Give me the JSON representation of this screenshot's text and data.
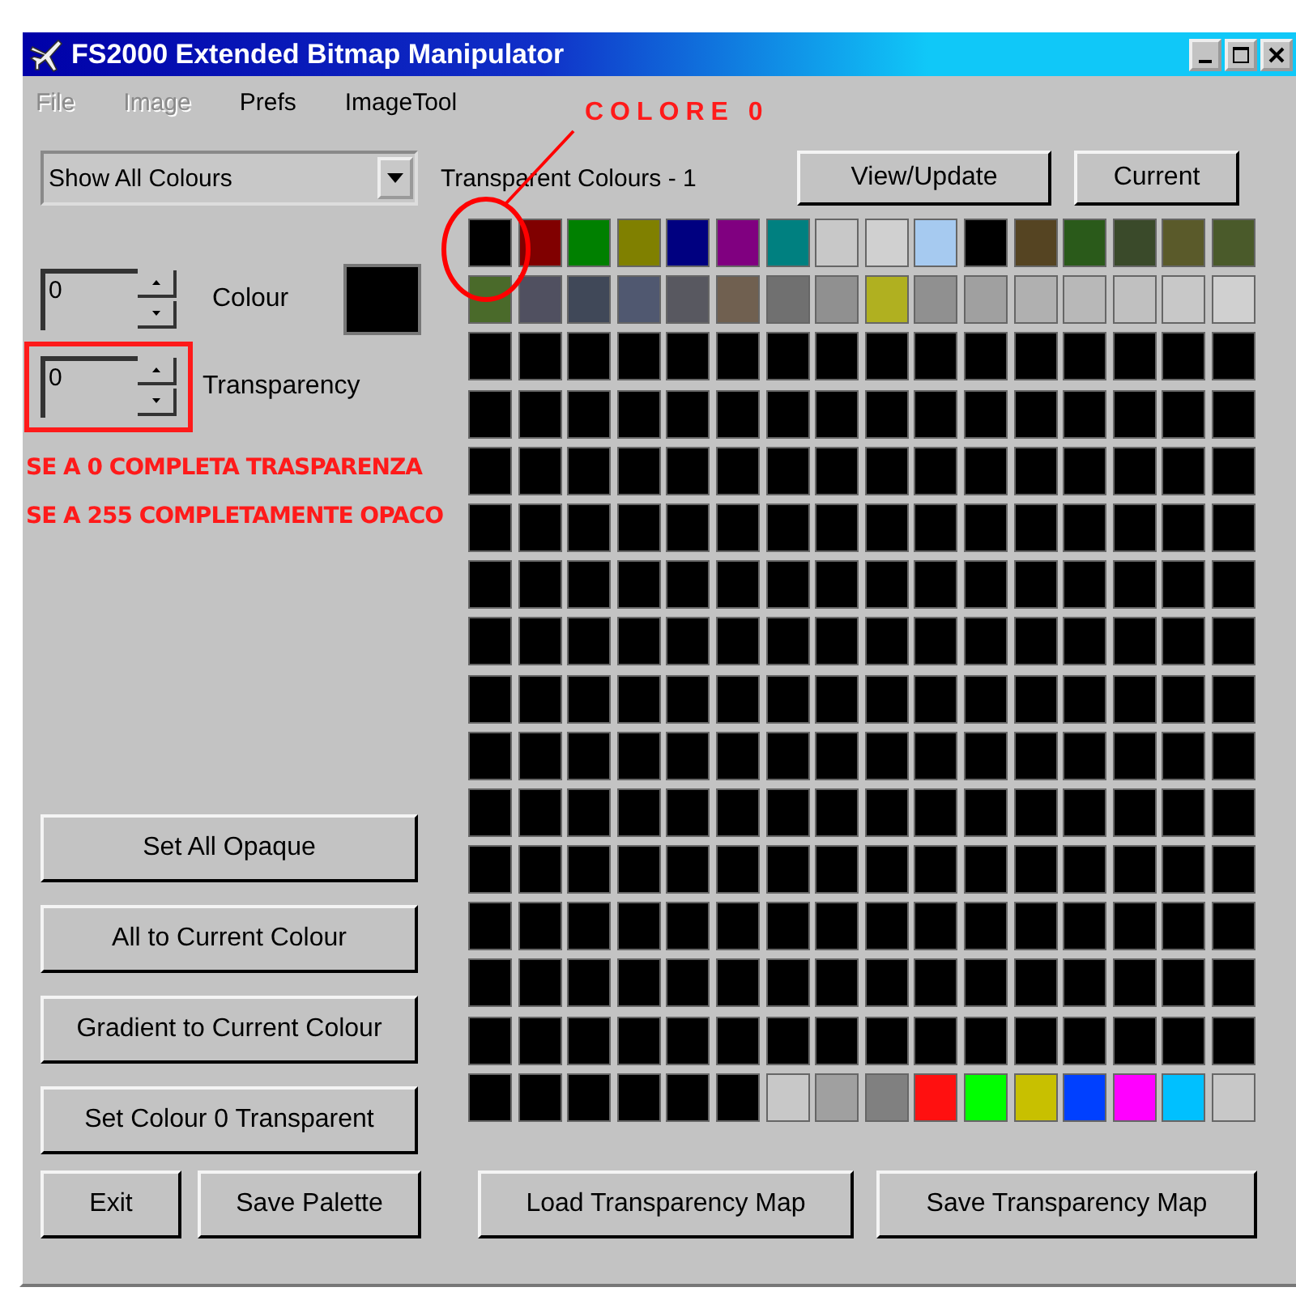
{
  "window": {
    "title": "FS2000 Extended Bitmap Manipulator"
  },
  "menu": [
    {
      "label": "File",
      "disabled": true
    },
    {
      "label": "Image",
      "disabled": true
    },
    {
      "label": "Prefs",
      "disabled": false
    },
    {
      "label": "ImageTool",
      "disabled": false
    }
  ],
  "left": {
    "dropdown": "Show All Colours",
    "colour_spinner": {
      "value": "0",
      "label": "Colour"
    },
    "transparency_spinner": {
      "value": "0",
      "label": "Transparency"
    },
    "buttons": [
      "Set All Opaque",
      "All to Current Colour",
      "Gradient to Current Colour",
      "Set Colour 0 Transparent"
    ]
  },
  "palette": {
    "label": "Transparent Colours - 1",
    "buttons": [
      "View/Update",
      "Current"
    ],
    "rows": [
      {
        "cells": [
          {
            "color": "#000000"
          },
          {
            "color": "#800000"
          },
          {
            "color": "#008000"
          },
          {
            "color": "#808000"
          },
          {
            "color": "#000080"
          },
          {
            "color": "#800080"
          },
          {
            "color": "#008080"
          },
          {
            "color": "#c8c8c8"
          },
          {
            "color": "#d0d0d0"
          },
          {
            "color": "#a6caf0"
          },
          {
            "color": "#000000"
          },
          {
            "color": "#554422"
          },
          {
            "color": "#2a5a1a"
          },
          {
            "color": "#3a4a2a"
          },
          {
            "color": "#5a5a2a"
          },
          {
            "color": "#4a5a2a"
          }
        ]
      },
      {
        "cells": [
          {
            "color": "#4a6a2a"
          },
          {
            "color": "#505060"
          },
          {
            "color": "#404858"
          },
          {
            "color": "#505870"
          },
          {
            "color": "#585860"
          },
          {
            "color": "#706050"
          },
          {
            "color": "#707070"
          },
          {
            "color": "#909090"
          },
          {
            "color": "#b0b020"
          },
          {
            "color": "#909090"
          },
          {
            "color": "#a0a0a0"
          },
          {
            "color": "#b0b0b0"
          },
          {
            "color": "#b8b8b8"
          },
          {
            "color": "#c0c0c0"
          },
          {
            "color": "#c8c8c8"
          },
          {
            "color": "#d0d0d0"
          }
        ]
      },
      {
        "cells": [
          {
            "color": "#000000"
          },
          {
            "color": "#000000"
          },
          {
            "color": "#000000"
          },
          {
            "color": "#000000"
          },
          {
            "color": "#000000"
          },
          {
            "color": "#000000"
          },
          {
            "color": "#000000"
          },
          {
            "color": "#000000"
          },
          {
            "color": "#000000"
          },
          {
            "color": "#000000"
          },
          {
            "color": "#000000"
          },
          {
            "color": "#000000"
          },
          {
            "color": "#000000"
          },
          {
            "color": "#000000"
          },
          {
            "color": "#000000"
          },
          {
            "color": "#000000"
          }
        ]
      },
      {
        "cells": [
          {
            "color": "#000000"
          },
          {
            "color": "#000000"
          },
          {
            "color": "#000000"
          },
          {
            "color": "#000000"
          },
          {
            "color": "#000000"
          },
          {
            "color": "#000000"
          },
          {
            "color": "#000000"
          },
          {
            "color": "#000000"
          },
          {
            "color": "#000000"
          },
          {
            "color": "#000000"
          },
          {
            "color": "#000000"
          },
          {
            "color": "#000000"
          },
          {
            "color": "#000000"
          },
          {
            "color": "#000000"
          },
          {
            "color": "#000000"
          },
          {
            "color": "#000000"
          }
        ]
      },
      {
        "cells": [
          {
            "color": "#000000"
          },
          {
            "color": "#000000"
          },
          {
            "color": "#000000"
          },
          {
            "color": "#000000"
          },
          {
            "color": "#000000"
          },
          {
            "color": "#000000"
          },
          {
            "color": "#000000"
          },
          {
            "color": "#000000"
          },
          {
            "color": "#000000"
          },
          {
            "color": "#000000"
          },
          {
            "color": "#000000"
          },
          {
            "color": "#000000"
          },
          {
            "color": "#000000"
          },
          {
            "color": "#000000"
          },
          {
            "color": "#000000"
          },
          {
            "color": "#000000"
          }
        ]
      },
      {
        "cells": [
          {
            "color": "#000000"
          },
          {
            "color": "#000000"
          },
          {
            "color": "#000000"
          },
          {
            "color": "#000000"
          },
          {
            "color": "#000000"
          },
          {
            "color": "#000000"
          },
          {
            "color": "#000000"
          },
          {
            "color": "#000000"
          },
          {
            "color": "#000000"
          },
          {
            "color": "#000000"
          },
          {
            "color": "#000000"
          },
          {
            "color": "#000000"
          },
          {
            "color": "#000000"
          },
          {
            "color": "#000000"
          },
          {
            "color": "#000000"
          },
          {
            "color": "#000000"
          }
        ]
      },
      {
        "cells": [
          {
            "color": "#000000"
          },
          {
            "color": "#000000"
          },
          {
            "color": "#000000"
          },
          {
            "color": "#000000"
          },
          {
            "color": "#000000"
          },
          {
            "color": "#000000"
          },
          {
            "color": "#000000"
          },
          {
            "color": "#000000"
          },
          {
            "color": "#000000"
          },
          {
            "color": "#000000"
          },
          {
            "color": "#000000"
          },
          {
            "color": "#000000"
          },
          {
            "color": "#000000"
          },
          {
            "color": "#000000"
          },
          {
            "color": "#000000"
          },
          {
            "color": "#000000"
          }
        ]
      },
      {
        "cells": [
          {
            "color": "#000000"
          },
          {
            "color": "#000000"
          },
          {
            "color": "#000000"
          },
          {
            "color": "#000000"
          },
          {
            "color": "#000000"
          },
          {
            "color": "#000000"
          },
          {
            "color": "#000000"
          },
          {
            "color": "#000000"
          },
          {
            "color": "#000000"
          },
          {
            "color": "#000000"
          },
          {
            "color": "#000000"
          },
          {
            "color": "#000000"
          },
          {
            "color": "#000000"
          },
          {
            "color": "#000000"
          },
          {
            "color": "#000000"
          },
          {
            "color": "#000000"
          }
        ]
      },
      {
        "cells": [
          {
            "color": "#000000"
          },
          {
            "color": "#000000"
          },
          {
            "color": "#000000"
          },
          {
            "color": "#000000"
          },
          {
            "color": "#000000"
          },
          {
            "color": "#000000"
          },
          {
            "color": "#000000"
          },
          {
            "color": "#000000"
          },
          {
            "color": "#000000"
          },
          {
            "color": "#000000"
          },
          {
            "color": "#000000"
          },
          {
            "color": "#000000"
          },
          {
            "color": "#000000"
          },
          {
            "color": "#000000"
          },
          {
            "color": "#000000"
          },
          {
            "color": "#000000"
          }
        ]
      },
      {
        "cells": [
          {
            "color": "#000000"
          },
          {
            "color": "#000000"
          },
          {
            "color": "#000000"
          },
          {
            "color": "#000000"
          },
          {
            "color": "#000000"
          },
          {
            "color": "#000000"
          },
          {
            "color": "#000000"
          },
          {
            "color": "#000000"
          },
          {
            "color": "#000000"
          },
          {
            "color": "#000000"
          },
          {
            "color": "#000000"
          },
          {
            "color": "#000000"
          },
          {
            "color": "#000000"
          },
          {
            "color": "#000000"
          },
          {
            "color": "#000000"
          },
          {
            "color": "#000000"
          }
        ]
      },
      {
        "cells": [
          {
            "color": "#000000"
          },
          {
            "color": "#000000"
          },
          {
            "color": "#000000"
          },
          {
            "color": "#000000"
          },
          {
            "color": "#000000"
          },
          {
            "color": "#000000"
          },
          {
            "color": "#000000"
          },
          {
            "color": "#000000"
          },
          {
            "color": "#000000"
          },
          {
            "color": "#000000"
          },
          {
            "color": "#000000"
          },
          {
            "color": "#000000"
          },
          {
            "color": "#000000"
          },
          {
            "color": "#000000"
          },
          {
            "color": "#000000"
          },
          {
            "color": "#000000"
          }
        ]
      },
      {
        "cells": [
          {
            "color": "#000000"
          },
          {
            "color": "#000000"
          },
          {
            "color": "#000000"
          },
          {
            "color": "#000000"
          },
          {
            "color": "#000000"
          },
          {
            "color": "#000000"
          },
          {
            "color": "#000000"
          },
          {
            "color": "#000000"
          },
          {
            "color": "#000000"
          },
          {
            "color": "#000000"
          },
          {
            "color": "#000000"
          },
          {
            "color": "#000000"
          },
          {
            "color": "#000000"
          },
          {
            "color": "#000000"
          },
          {
            "color": "#000000"
          },
          {
            "color": "#000000"
          }
        ]
      },
      {
        "cells": [
          {
            "color": "#000000"
          },
          {
            "color": "#000000"
          },
          {
            "color": "#000000"
          },
          {
            "color": "#000000"
          },
          {
            "color": "#000000"
          },
          {
            "color": "#000000"
          },
          {
            "color": "#000000"
          },
          {
            "color": "#000000"
          },
          {
            "color": "#000000"
          },
          {
            "color": "#000000"
          },
          {
            "color": "#000000"
          },
          {
            "color": "#000000"
          },
          {
            "color": "#000000"
          },
          {
            "color": "#000000"
          },
          {
            "color": "#000000"
          },
          {
            "color": "#000000"
          }
        ]
      },
      {
        "cells": [
          {
            "color": "#000000"
          },
          {
            "color": "#000000"
          },
          {
            "color": "#000000"
          },
          {
            "color": "#000000"
          },
          {
            "color": "#000000"
          },
          {
            "color": "#000000"
          },
          {
            "color": "#000000"
          },
          {
            "color": "#000000"
          },
          {
            "color": "#000000"
          },
          {
            "color": "#000000"
          },
          {
            "color": "#000000"
          },
          {
            "color": "#000000"
          },
          {
            "color": "#000000"
          },
          {
            "color": "#000000"
          },
          {
            "color": "#000000"
          },
          {
            "color": "#000000"
          }
        ]
      },
      {
        "cells": [
          {
            "color": "#000000"
          },
          {
            "color": "#000000"
          },
          {
            "color": "#000000"
          },
          {
            "color": "#000000"
          },
          {
            "color": "#000000"
          },
          {
            "color": "#000000"
          },
          {
            "color": "#000000"
          },
          {
            "color": "#000000"
          },
          {
            "color": "#000000"
          },
          {
            "color": "#000000"
          },
          {
            "color": "#000000"
          },
          {
            "color": "#000000"
          },
          {
            "color": "#000000"
          },
          {
            "color": "#000000"
          },
          {
            "color": "#000000"
          },
          {
            "color": "#000000"
          }
        ]
      },
      {
        "cells": [
          {
            "color": "#000000"
          },
          {
            "color": "#000000"
          },
          {
            "color": "#000000"
          },
          {
            "color": "#000000"
          },
          {
            "color": "#000000"
          },
          {
            "color": "#000000"
          },
          {
            "color": "#c8c8c8"
          },
          {
            "color": "#a0a0a0"
          },
          {
            "color": "#808080"
          },
          {
            "color": "#ff1010"
          },
          {
            "color": "#00ff00"
          },
          {
            "color": "#c8c000"
          },
          {
            "color": "#0040ff"
          },
          {
            "color": "#ff00ff"
          },
          {
            "color": "#00c0ff"
          },
          {
            "color": "#c8c8c8"
          }
        ]
      }
    ]
  },
  "bottom_buttons": [
    "Exit",
    "Save Palette",
    "Load Transparency Map",
    "Save Transparency Map"
  ],
  "annotations": {
    "callout": "COLORE 0",
    "notes": [
      "SE A 0 COMPLETA TRASPARENZA",
      "SE A 255 COMPLETAMENTE OPACO"
    ]
  }
}
